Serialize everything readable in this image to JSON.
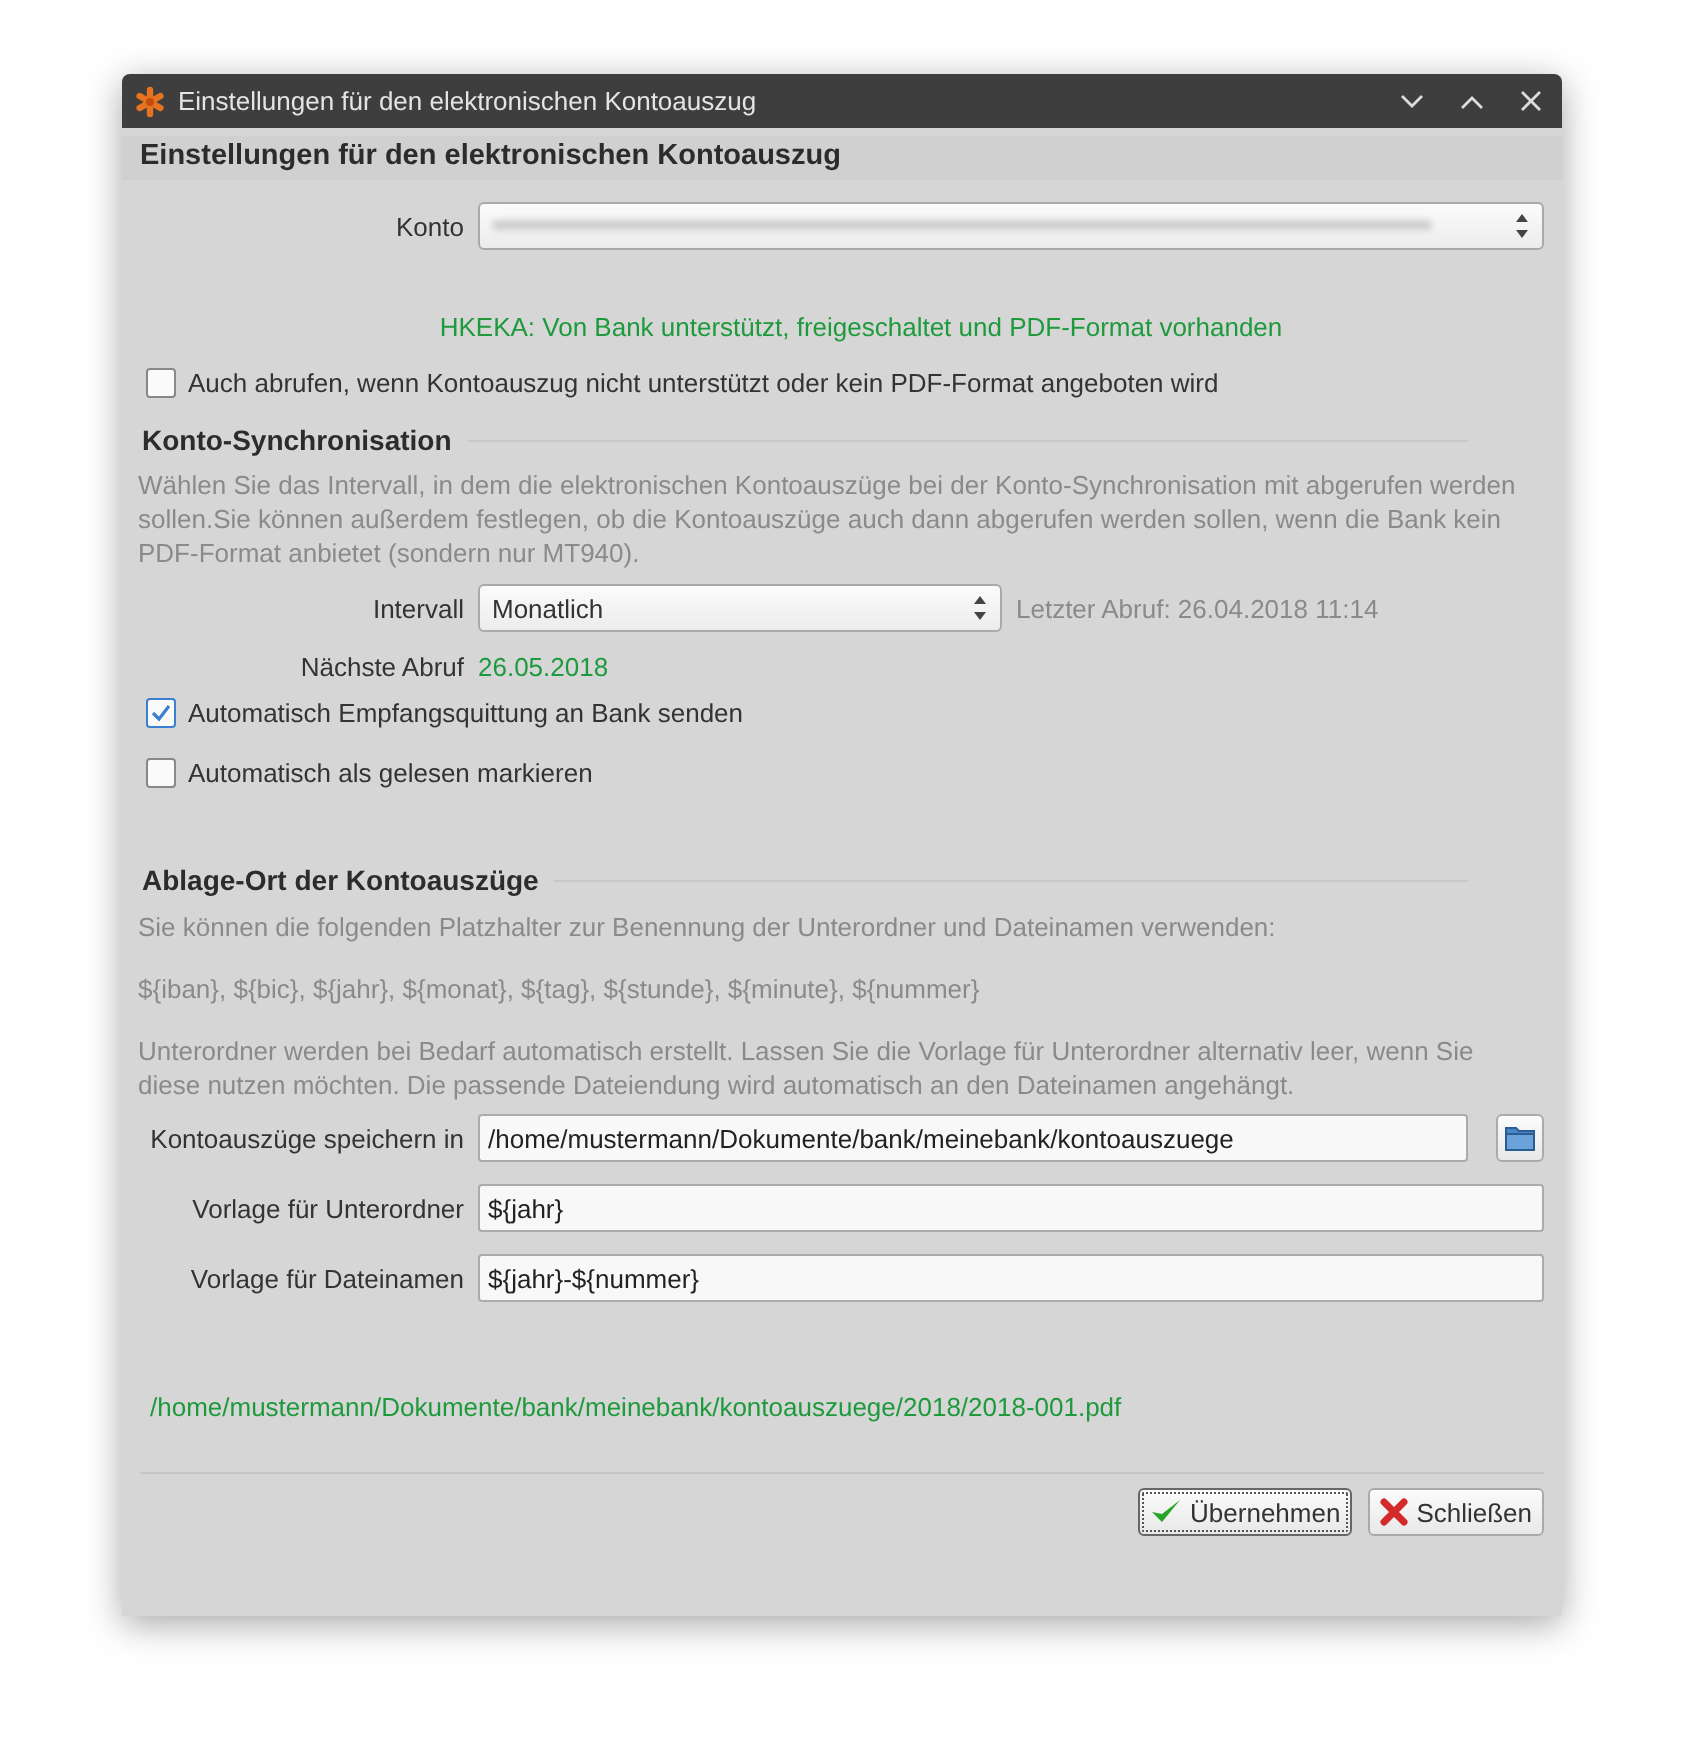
{
  "window": {
    "title": "Einstellungen für den elektronischen Kontoauszug"
  },
  "heading": "Einstellungen für den elektronischen Kontoauszug",
  "konto": {
    "label": "Konto"
  },
  "status": "HKEKA: Von Bank unterstützt, freigeschaltet und PDF-Format vorhanden",
  "fetch_always": {
    "label": "Auch abrufen, wenn Kontoauszug nicht unterstützt oder kein PDF-Format angeboten wird",
    "checked": false
  },
  "sync": {
    "title": "Konto-Synchronisation",
    "description": "Wählen Sie das Intervall, in dem die elektronischen Kontoauszüge bei der Konto-Synchronisation mit abgerufen werden sollen.Sie können außerdem festlegen, ob die Kontoauszüge auch dann abgerufen werden sollen, wenn die Bank kein PDF-Format anbietet (sondern nur MT940).",
    "interval_label": "Intervall",
    "interval_value": "Monatlich",
    "last_fetch": "Letzter Abruf: 26.04.2018 11:14",
    "next_label": "Nächste Abruf",
    "next_value": "26.05.2018",
    "options": [
      {
        "label": "Automatisch Empfangsquittung an Bank senden",
        "checked": true
      },
      {
        "label": "Automatisch als gelesen markieren",
        "checked": false
      }
    ]
  },
  "storage": {
    "title": "Ablage-Ort der Kontoauszüge",
    "intro": "Sie können die folgenden Platzhalter zur Benennung der Unterordner und Dateinamen verwenden:",
    "placeholders": "${iban}, ${bic}, ${jahr}, ${monat}, ${tag}, ${stunde}, ${minute}, ${nummer}",
    "note": "Unterordner werden bei Bedarf automatisch erstellt. Lassen Sie die Vorlage für Unterordner alternativ leer, wenn Sie diese nutzen möchten. Die passende Dateiendung wird automatisch an den Dateinamen angehängt.",
    "fields": [
      {
        "label": "Kontoauszüge speichern in",
        "value": "/home/mustermann/Dokumente/bank/meinebank/kontoauszuege",
        "kind": "folder"
      },
      {
        "label": "Vorlage für Unterordner",
        "value": "${jahr}",
        "kind": "text"
      },
      {
        "label": "Vorlage für Dateinamen",
        "value": "${jahr}-${nummer}",
        "kind": "text"
      }
    ],
    "preview": "/home/mustermann/Dokumente/bank/meinebank/kontoauszuege/2018/2018-001.pdf"
  },
  "buttons": [
    {
      "label": "Übernehmen",
      "kind": "apply"
    },
    {
      "label": "Schließen",
      "kind": "close"
    }
  ]
}
